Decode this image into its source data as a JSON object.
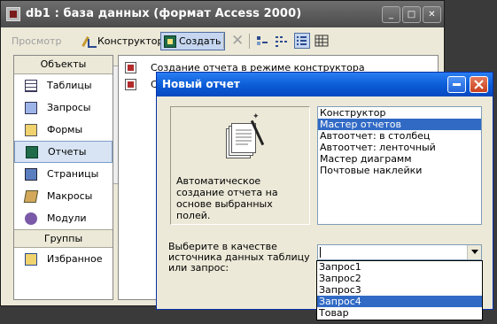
{
  "db_window": {
    "title": "db1 : база данных (формат Access 2000)",
    "window_buttons": {
      "minimize": "_",
      "maximize": "□",
      "close": "✕"
    },
    "toolbar": {
      "preview_label": "Просмотр",
      "design_label": "Конструктор",
      "create_label": "Создать"
    },
    "objects_header": "Объекты",
    "nav_items": [
      {
        "label": "Таблицы",
        "icon": "tables-icon"
      },
      {
        "label": "Запросы",
        "icon": "queries-icon"
      },
      {
        "label": "Формы",
        "icon": "forms-icon"
      },
      {
        "label": "Отчеты",
        "icon": "reports-icon",
        "selected": true
      },
      {
        "label": "Страницы",
        "icon": "pages-icon"
      },
      {
        "label": "Макросы",
        "icon": "macros-icon"
      },
      {
        "label": "Модули",
        "icon": "modules-icon"
      }
    ],
    "groups_header": "Группы",
    "favorites_label": "Избранное",
    "content_items": [
      "Создание отчета в режиме конструктора",
      "Со"
    ]
  },
  "dialog": {
    "title": "Новый отчет",
    "description": "Автоматическое создание отчета на основе выбранных полей.",
    "report_types": [
      {
        "label": "Конструктор"
      },
      {
        "label": "Мастер отчетов",
        "selected": true
      },
      {
        "label": "Автоотчет: в столбец"
      },
      {
        "label": "Автоотчет: ленточный"
      },
      {
        "label": "Мастер диаграмм"
      },
      {
        "label": "Почтовые наклейки"
      }
    ],
    "source_label": "Выберите в качестве источника данных таблицу или запрос:",
    "source_value": "",
    "source_options": [
      {
        "label": "Запрос1"
      },
      {
        "label": "Запрос2"
      },
      {
        "label": "Запрос3"
      },
      {
        "label": "Запрос4",
        "selected": true
      },
      {
        "label": "Товар"
      }
    ]
  },
  "colors": {
    "selection": "#316ac5",
    "dialog_titlebar": "#0a5bd6",
    "window_bg": "#ece9d8"
  }
}
